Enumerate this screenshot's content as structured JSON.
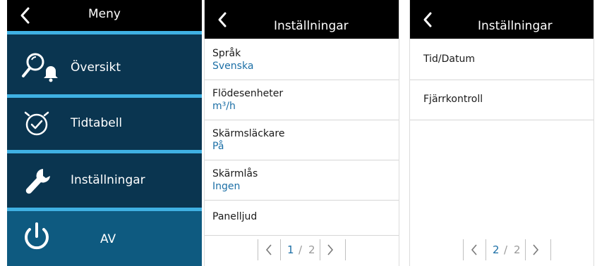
{
  "menu": {
    "title": "Meny",
    "items": [
      {
        "label": "Översikt",
        "icon": "overview-alarm-icon"
      },
      {
        "label": "Tidtabell",
        "icon": "clock-check-icon"
      },
      {
        "label": "Inställningar",
        "icon": "wrench-icon"
      },
      {
        "label": "AV",
        "icon": "power-icon"
      }
    ]
  },
  "settings_page1": {
    "title": "Inställningar",
    "rows": [
      {
        "label": "Språk",
        "value": "Svenska"
      },
      {
        "label": "Flödesenheter",
        "value": "m³/h"
      },
      {
        "label": "Skärmsläckare",
        "value": "På"
      },
      {
        "label": "Skärmlås",
        "value": "Ingen"
      },
      {
        "label": "Panelljud"
      }
    ],
    "pager": {
      "current": "1",
      "separator": "/",
      "total": "2"
    }
  },
  "settings_page2": {
    "title": "Inställningar",
    "rows": [
      {
        "label": "Tid/Datum"
      },
      {
        "label": "Fjärrkontroll"
      }
    ],
    "pager": {
      "current": "2",
      "separator": "/",
      "total": "2"
    }
  },
  "colors": {
    "menu_bg": "#0a3550",
    "menu_separator": "#3fb1e3",
    "power_bg": "#0e5a80",
    "header_bg": "#000000",
    "value_text": "#1c6fa6"
  }
}
